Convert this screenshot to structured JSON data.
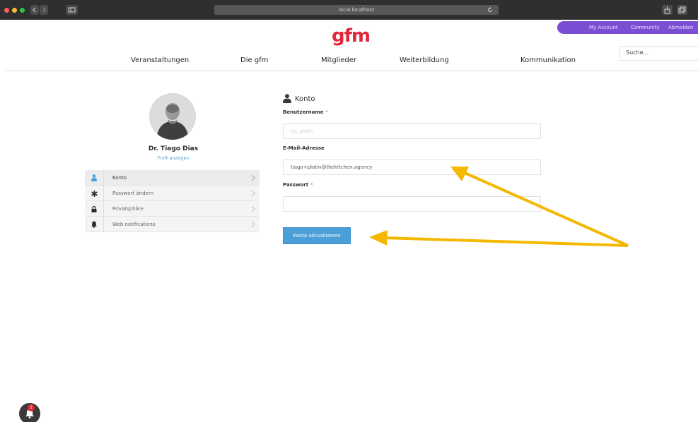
{
  "browser": {
    "url": "local.localhost",
    "traffic_light_colors": [
      "#ff5f57",
      "#febc2e",
      "#28c840"
    ]
  },
  "header": {
    "logo": "gfm",
    "logo_color": "#e3263a",
    "account_bar_color": "#7a4fd4",
    "account_links": [
      "My Account",
      "Community",
      "Abmelden"
    ],
    "search_placeholder": "Suche...",
    "nav": [
      "Veranstaltungen",
      "Die gfm",
      "Mitglieder",
      "Weiterbildung",
      "Kommunikation"
    ]
  },
  "profile": {
    "name": "Dr. Tiago Dias",
    "view_link": "Profil anzeigen",
    "menu": [
      {
        "label": "Konto",
        "icon": "user-icon",
        "active": true
      },
      {
        "label": "Passwort ändern",
        "icon": "asterisk-icon",
        "active": false
      },
      {
        "label": "Privatsphäre",
        "icon": "lock-icon",
        "active": false
      },
      {
        "label": "Web notifications",
        "icon": "bell-icon",
        "active": false
      }
    ]
  },
  "form": {
    "section_title": "Konto",
    "username_label": "Benutzername",
    "username_value": "tia_platin",
    "email_label": "E-Mail-Adresse",
    "email_value": "tiago+platin@thekitchen.agency",
    "password_label": "Passwort",
    "password_value": "",
    "required_marker": "*",
    "submit_label": "Konto aktualisieren",
    "accent_color": "#4a9fd8"
  },
  "annotations": {
    "arrow_color": "#f5b800",
    "arrow_targets": [
      "email-field",
      "submit-button"
    ]
  },
  "notifications": {
    "badge_count": "1"
  }
}
